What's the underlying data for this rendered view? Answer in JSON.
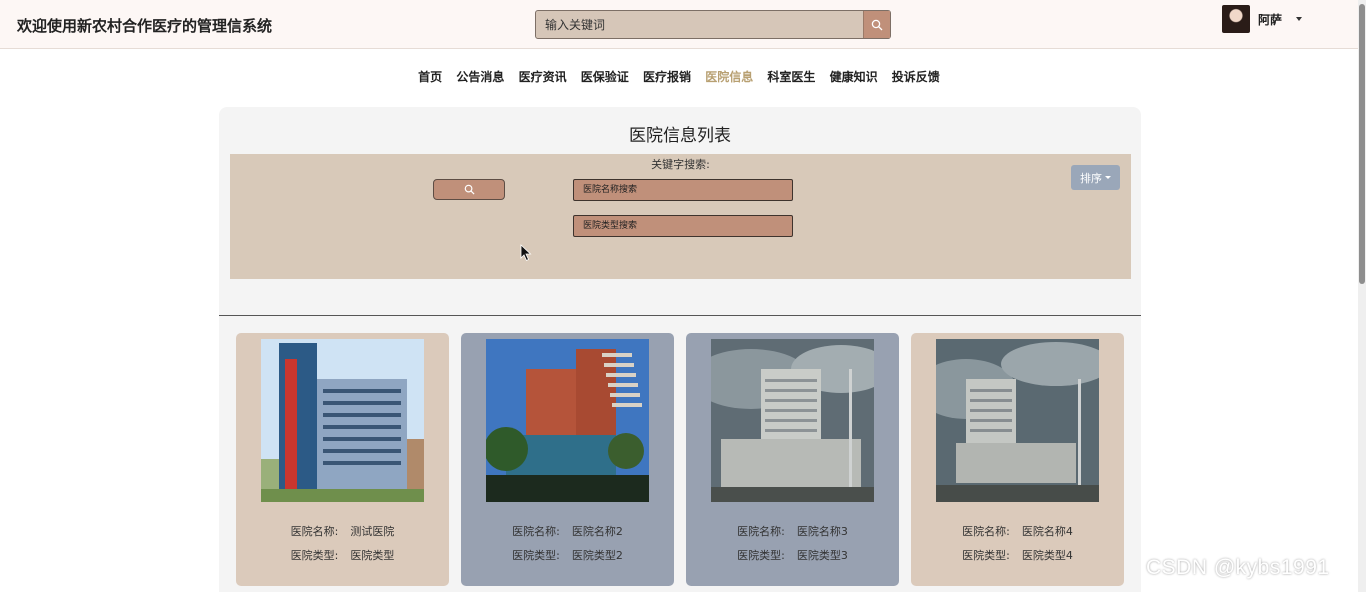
{
  "header": {
    "title": "欢迎使用新农村合作医疗的管理信系统",
    "search_placeholder": "输入关键词",
    "user_name": "阿萨"
  },
  "nav": {
    "items": [
      "首页",
      "公告消息",
      "医疗资讯",
      "医保验证",
      "医疗报销",
      "医院信息",
      "科室医生",
      "健康知识",
      "投诉反馈"
    ],
    "active": "医院信息"
  },
  "panel": {
    "title": "医院信息列表",
    "filter_label": "关键字搜索:",
    "name_placeholder": "医院名称搜索",
    "type_placeholder": "医院类型搜索",
    "sort_label": "排序"
  },
  "cards": {
    "name_label": "医院名称:",
    "type_label": "医院类型:",
    "items": [
      {
        "name": "测试医院",
        "type": "医院类型"
      },
      {
        "name": "医院名称2",
        "type": "医院类型2"
      },
      {
        "name": "医院名称3",
        "type": "医院类型3"
      },
      {
        "name": "医院名称4",
        "type": "医院类型4"
      }
    ]
  },
  "watermark": "CSDN @kybs1991",
  "colors": {
    "header_bg": "#fdf7f5",
    "accent_brown": "#c0907a",
    "filter_bg": "#d8c9b9",
    "card_tan": "#dbcabb",
    "card_blue": "#98a1b1",
    "nav_active": "#b8a072",
    "sort_button": "#9aa7b9"
  },
  "icons": {
    "search": "search-icon",
    "caret": "chevron-down-icon"
  }
}
